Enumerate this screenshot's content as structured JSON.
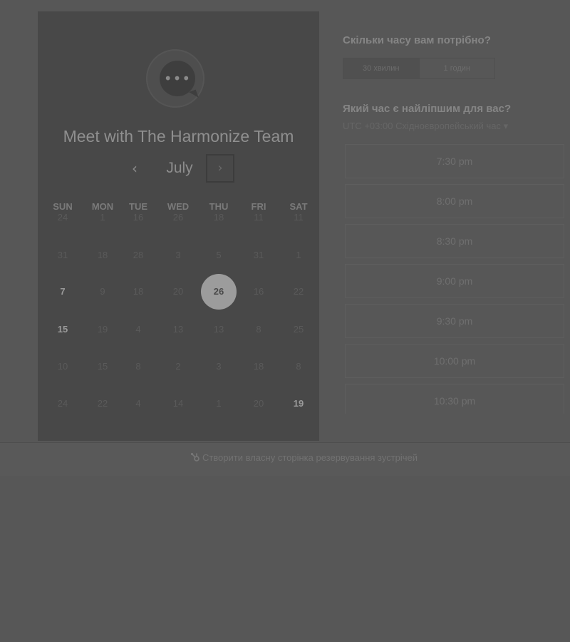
{
  "left": {
    "title": "Meet with The Harmonize Team",
    "logo_icon": "chat-bubble-dots-icon",
    "month": "July",
    "prev_icon": "‹",
    "next_icon": "›",
    "days_of_week": [
      "SUN",
      "MON",
      "TUE",
      "WED",
      "THU",
      "FRI",
      "SAT"
    ],
    "weeks": [
      [
        "24",
        "1",
        "16",
        "26",
        "18",
        "11",
        "11"
      ],
      [
        "31",
        "18",
        "28",
        "3",
        "5",
        "31",
        "1"
      ],
      [
        "7",
        "9",
        "18",
        "20",
        "26",
        "16",
        "22"
      ],
      [
        "15",
        "19",
        "4",
        "13",
        "13",
        "8",
        "25"
      ],
      [
        "10",
        "15",
        "8",
        "2",
        "3",
        "18",
        "8"
      ],
      [
        "24",
        "22",
        "4",
        "14",
        "1",
        "20",
        "19"
      ]
    ],
    "available_days": [
      "7",
      "15",
      "19"
    ],
    "selected_day": "26"
  },
  "right": {
    "duration_heading": "Скільки часу вам потрібно?",
    "duration_options": [
      "30 хвилин",
      "1 годин"
    ],
    "time_heading": "Який час є найліпшим для вас?",
    "timezone": "UTC +03:00 Східноєвропейський час ▾",
    "slots": [
      "7:30 pm",
      "8:00 pm",
      "8:30 pm",
      "9:00 pm",
      "9:30 pm",
      "10:00 pm",
      "10:30 pm"
    ]
  },
  "footer": {
    "link_icon": "hubspot-sprocket-icon",
    "link_text": "Створити власну сторінка резервування зустрічей"
  }
}
